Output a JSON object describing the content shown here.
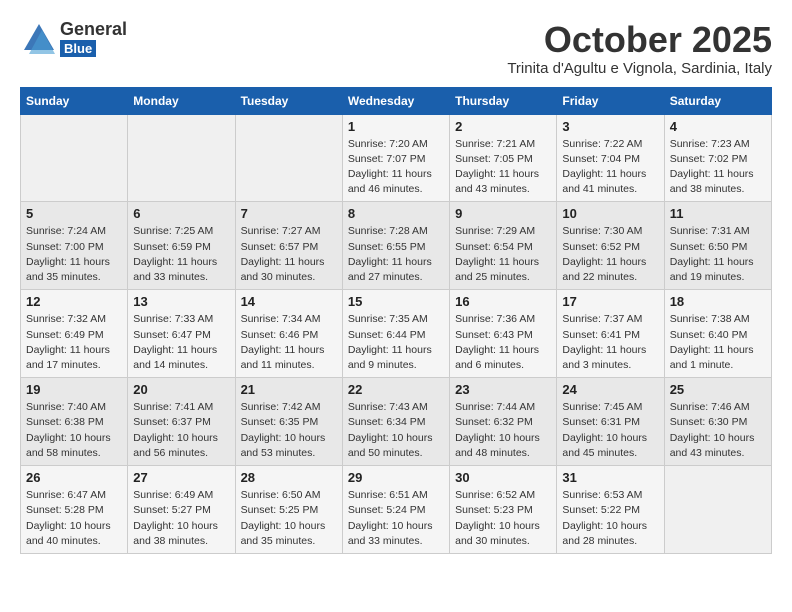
{
  "header": {
    "logo_general": "General",
    "logo_blue": "Blue",
    "month_title": "October 2025",
    "location": "Trinita d'Agultu e Vignola, Sardinia, Italy"
  },
  "days_of_week": [
    "Sunday",
    "Monday",
    "Tuesday",
    "Wednesday",
    "Thursday",
    "Friday",
    "Saturday"
  ],
  "weeks": [
    [
      {
        "day": "",
        "info": ""
      },
      {
        "day": "",
        "info": ""
      },
      {
        "day": "",
        "info": ""
      },
      {
        "day": "1",
        "info": "Sunrise: 7:20 AM\nSunset: 7:07 PM\nDaylight: 11 hours and 46 minutes."
      },
      {
        "day": "2",
        "info": "Sunrise: 7:21 AM\nSunset: 7:05 PM\nDaylight: 11 hours and 43 minutes."
      },
      {
        "day": "3",
        "info": "Sunrise: 7:22 AM\nSunset: 7:04 PM\nDaylight: 11 hours and 41 minutes."
      },
      {
        "day": "4",
        "info": "Sunrise: 7:23 AM\nSunset: 7:02 PM\nDaylight: 11 hours and 38 minutes."
      }
    ],
    [
      {
        "day": "5",
        "info": "Sunrise: 7:24 AM\nSunset: 7:00 PM\nDaylight: 11 hours and 35 minutes."
      },
      {
        "day": "6",
        "info": "Sunrise: 7:25 AM\nSunset: 6:59 PM\nDaylight: 11 hours and 33 minutes."
      },
      {
        "day": "7",
        "info": "Sunrise: 7:27 AM\nSunset: 6:57 PM\nDaylight: 11 hours and 30 minutes."
      },
      {
        "day": "8",
        "info": "Sunrise: 7:28 AM\nSunset: 6:55 PM\nDaylight: 11 hours and 27 minutes."
      },
      {
        "day": "9",
        "info": "Sunrise: 7:29 AM\nSunset: 6:54 PM\nDaylight: 11 hours and 25 minutes."
      },
      {
        "day": "10",
        "info": "Sunrise: 7:30 AM\nSunset: 6:52 PM\nDaylight: 11 hours and 22 minutes."
      },
      {
        "day": "11",
        "info": "Sunrise: 7:31 AM\nSunset: 6:50 PM\nDaylight: 11 hours and 19 minutes."
      }
    ],
    [
      {
        "day": "12",
        "info": "Sunrise: 7:32 AM\nSunset: 6:49 PM\nDaylight: 11 hours and 17 minutes."
      },
      {
        "day": "13",
        "info": "Sunrise: 7:33 AM\nSunset: 6:47 PM\nDaylight: 11 hours and 14 minutes."
      },
      {
        "day": "14",
        "info": "Sunrise: 7:34 AM\nSunset: 6:46 PM\nDaylight: 11 hours and 11 minutes."
      },
      {
        "day": "15",
        "info": "Sunrise: 7:35 AM\nSunset: 6:44 PM\nDaylight: 11 hours and 9 minutes."
      },
      {
        "day": "16",
        "info": "Sunrise: 7:36 AM\nSunset: 6:43 PM\nDaylight: 11 hours and 6 minutes."
      },
      {
        "day": "17",
        "info": "Sunrise: 7:37 AM\nSunset: 6:41 PM\nDaylight: 11 hours and 3 minutes."
      },
      {
        "day": "18",
        "info": "Sunrise: 7:38 AM\nSunset: 6:40 PM\nDaylight: 11 hours and 1 minute."
      }
    ],
    [
      {
        "day": "19",
        "info": "Sunrise: 7:40 AM\nSunset: 6:38 PM\nDaylight: 10 hours and 58 minutes."
      },
      {
        "day": "20",
        "info": "Sunrise: 7:41 AM\nSunset: 6:37 PM\nDaylight: 10 hours and 56 minutes."
      },
      {
        "day": "21",
        "info": "Sunrise: 7:42 AM\nSunset: 6:35 PM\nDaylight: 10 hours and 53 minutes."
      },
      {
        "day": "22",
        "info": "Sunrise: 7:43 AM\nSunset: 6:34 PM\nDaylight: 10 hours and 50 minutes."
      },
      {
        "day": "23",
        "info": "Sunrise: 7:44 AM\nSunset: 6:32 PM\nDaylight: 10 hours and 48 minutes."
      },
      {
        "day": "24",
        "info": "Sunrise: 7:45 AM\nSunset: 6:31 PM\nDaylight: 10 hours and 45 minutes."
      },
      {
        "day": "25",
        "info": "Sunrise: 7:46 AM\nSunset: 6:30 PM\nDaylight: 10 hours and 43 minutes."
      }
    ],
    [
      {
        "day": "26",
        "info": "Sunrise: 6:47 AM\nSunset: 5:28 PM\nDaylight: 10 hours and 40 minutes."
      },
      {
        "day": "27",
        "info": "Sunrise: 6:49 AM\nSunset: 5:27 PM\nDaylight: 10 hours and 38 minutes."
      },
      {
        "day": "28",
        "info": "Sunrise: 6:50 AM\nSunset: 5:25 PM\nDaylight: 10 hours and 35 minutes."
      },
      {
        "day": "29",
        "info": "Sunrise: 6:51 AM\nSunset: 5:24 PM\nDaylight: 10 hours and 33 minutes."
      },
      {
        "day": "30",
        "info": "Sunrise: 6:52 AM\nSunset: 5:23 PM\nDaylight: 10 hours and 30 minutes."
      },
      {
        "day": "31",
        "info": "Sunrise: 6:53 AM\nSunset: 5:22 PM\nDaylight: 10 hours and 28 minutes."
      },
      {
        "day": "",
        "info": ""
      }
    ]
  ]
}
